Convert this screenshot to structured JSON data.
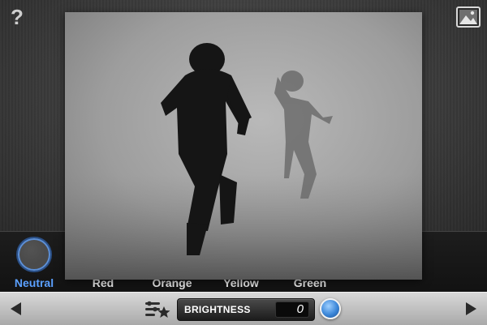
{
  "toolbar": {
    "help_icon": "question-icon",
    "help_label": "?",
    "gallery_icon": "image-gallery-icon"
  },
  "photo": {
    "description_icon": "foggy-photo"
  },
  "filters": {
    "selected": "Neutral",
    "items": [
      {
        "label": "Neutral",
        "color": "#4a4a4a"
      },
      {
        "label": "Red",
        "color": "#b3262f"
      },
      {
        "label": "Orange",
        "color": "#d86a1f"
      },
      {
        "label": "Yellow",
        "color": "#e3d43a"
      },
      {
        "label": "Green",
        "color": "#2f9a3c"
      }
    ]
  },
  "bottom": {
    "prev_icon": "left-arrow-icon",
    "next_icon": "right-arrow-icon",
    "favorites_icon": "sliders-star-icon",
    "adjustment_name": "BRIGHTNESS",
    "adjustment_value": "0",
    "dial_icon": "blue-dial-icon"
  },
  "colors": {
    "selected_label": "#5ba0ff",
    "filter_bar": "#161616",
    "bottom_bar": "#c4c4c4"
  }
}
